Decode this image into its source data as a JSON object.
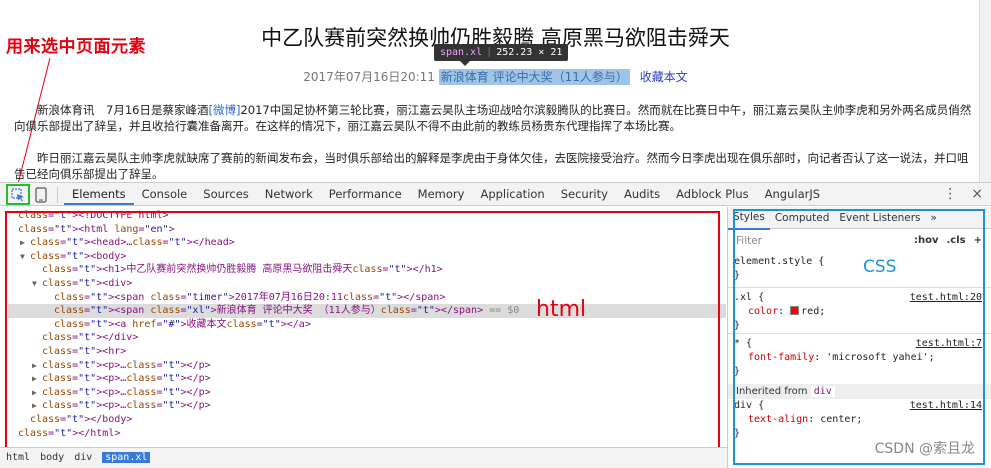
{
  "annotations": {
    "select_element_hint": "用来选中页面元素",
    "html_label": "html",
    "css_label": "CSS",
    "watermark": "CSDN @索且龙"
  },
  "page": {
    "title": "中乙队赛前突然换帅仍胜毅腾 高原黑马欲阻击舜天",
    "tooltip": {
      "tag": "span.xl",
      "size": "252.23 × 21"
    },
    "timer": "2017年07月16日20:11",
    "source_link": "新浪体育 评论中大奖（11人参与）",
    "favorite": "收藏本文",
    "paragraph1_a": "新浪体育讯　7月16日是蔡家峰酒",
    "paragraph1_link": "[微博]",
    "paragraph1_b": "2017中国足协杯第三轮比赛，丽江嘉云昊队主场迎战哈尔滨毅腾队的比赛日。然而就在比赛日中午，丽江嘉云昊队主帅李虎和另外两名成员俏然向俱乐部提出了辞呈，并且收拾行囊准备离开。在这样的情况下，丽江嘉云昊队不得不由此前的教练员杨贵东代理指挥了本场比赛。",
    "paragraph2": "昨日丽江嘉云昊队主帅李虎就缺席了赛前的新闻发布会，当时俱乐部给出的解释是李虎由于身体欠佳，去医院接受治疗。然而今日李虎出现在俱乐部时，向记者否认了这一说法，并口咀告已经向俱乐部提出了辞呈。"
  },
  "toolbar": {
    "inspect_icon": "cursor-select-icon",
    "device_icon": "device-toggle-icon",
    "tabs": [
      "Elements",
      "Console",
      "Sources",
      "Network",
      "Performance",
      "Memory",
      "Application",
      "Security",
      "Audits",
      "Adblock Plus",
      "AngularJS"
    ],
    "active_tab": "Elements",
    "more_icon": "⋮",
    "close_icon": "×"
  },
  "elements": {
    "rows": [
      {
        "indent": 0,
        "arrow": "",
        "html": "<!DOCTYPE html>"
      },
      {
        "indent": 0,
        "arrow": "",
        "html": "<html lang=\"en\">"
      },
      {
        "indent": 1,
        "arrow": "▶",
        "html": "<head>…</head>"
      },
      {
        "indent": 1,
        "arrow": "▼",
        "html": "<body>"
      },
      {
        "indent": 2,
        "arrow": "",
        "html": "<h1>中乙队赛前突然换帅仍胜毅腾 高原黑马欲阻击舜天</h1>"
      },
      {
        "indent": 2,
        "arrow": "▼",
        "html": "<div>"
      },
      {
        "indent": 3,
        "arrow": "",
        "html": "<span class=\"timer\">2017年07月16日20:11</span>"
      },
      {
        "indent": 3,
        "arrow": "",
        "html": "<span class=\"xl\">新浪体育 评论中大奖 （11人参与）</span> == $0"
      },
      {
        "indent": 3,
        "arrow": "",
        "html": "<a href=\"#\">收藏本文</a>"
      },
      {
        "indent": 2,
        "arrow": "",
        "html": "</div>"
      },
      {
        "indent": 2,
        "arrow": "",
        "html": "<hr>"
      },
      {
        "indent": 2,
        "arrow": "▶",
        "html": "<p>…</p>"
      },
      {
        "indent": 2,
        "arrow": "▶",
        "html": "<p>…</p>"
      },
      {
        "indent": 2,
        "arrow": "▶",
        "html": "<p>…</p>"
      },
      {
        "indent": 2,
        "arrow": "▶",
        "html": "<p>…</p>"
      },
      {
        "indent": 1,
        "arrow": "",
        "html": "</body>"
      },
      {
        "indent": 0,
        "arrow": "",
        "html": "</html>"
      }
    ],
    "selected_index": 7,
    "breadcrumbs": [
      "html",
      "body",
      "div",
      "span.xl"
    ]
  },
  "styles": {
    "tabs": [
      "Styles",
      "Computed",
      "Event Listeners",
      "»"
    ],
    "filter_placeholder": "Filter",
    "hov": ":hov",
    "cls": ".cls",
    "add": "+",
    "rules": [
      {
        "selector": "element.style {",
        "props": [],
        "close": "}",
        "source": ""
      },
      {
        "selector": ".xl {",
        "props": [
          {
            "name": "color",
            "value": "red;",
            "swatch": "#ff0000"
          }
        ],
        "close": "}",
        "source": "test.html:20"
      },
      {
        "selector": "* {",
        "props": [
          {
            "name": "font-family",
            "value": "'microsoft yahei';"
          }
        ],
        "close": "}",
        "source": "test.html:7"
      },
      {
        "selector": "div {",
        "props": [
          {
            "name": "text-align",
            "value": "center;"
          }
        ],
        "close": "}",
        "source": "test.html:14"
      }
    ],
    "inherited_label": "Inherited from",
    "inherited_tag": "div"
  }
}
